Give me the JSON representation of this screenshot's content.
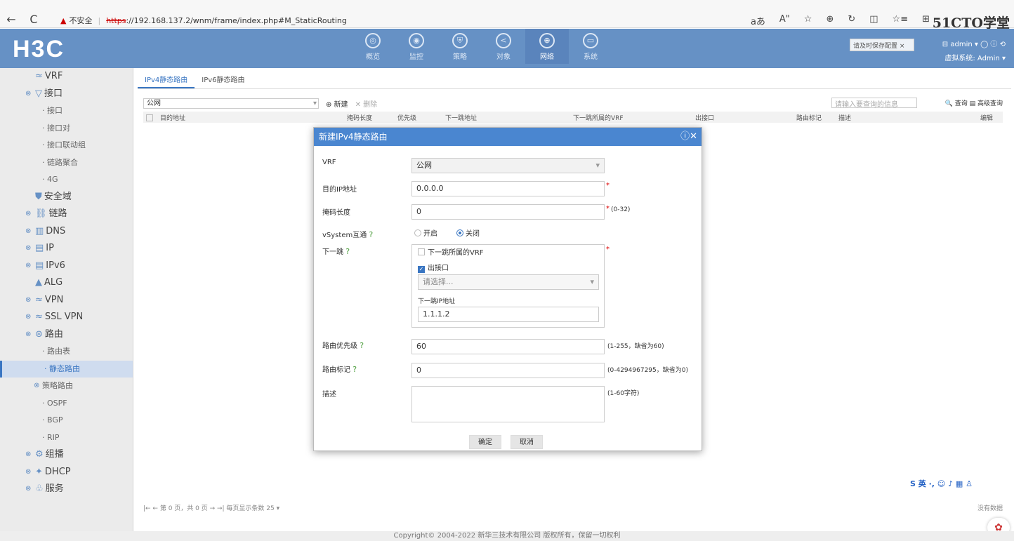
{
  "browser": {
    "back": "←",
    "reload": "C",
    "warning": "▲",
    "insecure": "不安全",
    "https": "https",
    "url": "://192.168.137.2/wnm/frame/index.php#M_StaticRouting",
    "icons": [
      "aあ",
      "A\"",
      "☆",
      "⊕",
      "↻",
      "◫",
      "☆≡",
      "⊞"
    ],
    "brand": "51CTO学堂"
  },
  "header": {
    "logo": "H3C",
    "nav": [
      {
        "icon": "◎",
        "label": "概览"
      },
      {
        "icon": "◉",
        "label": "监控"
      },
      {
        "icon": "⛨",
        "label": "策略"
      },
      {
        "icon": "<",
        "label": "对象"
      },
      {
        "icon": "⊕",
        "label": "网络"
      },
      {
        "icon": "▭",
        "label": "系统"
      }
    ],
    "save_hint": "请及时保存配置",
    "save_close": "×",
    "user": "⊟ admin ▾ ◯ ⓘ ⟲",
    "vsys": "虚拟系统: Admin ▾"
  },
  "sidebar": {
    "items": [
      {
        "label": "VRF",
        "icon": "≈",
        "expand": ""
      },
      {
        "label": "接口",
        "icon": "▽",
        "expand": "⊗"
      },
      {
        "label": "· 接口",
        "sub": true
      },
      {
        "label": "· 接口对",
        "sub": true
      },
      {
        "label": "· 接口联动组",
        "sub": true
      },
      {
        "label": "· 链路聚合",
        "sub": true
      },
      {
        "label": "· 4G",
        "sub": true
      },
      {
        "label": "安全域",
        "icon": "⛊",
        "expand": ""
      },
      {
        "label": "链路",
        "icon": "⛓",
        "expand": "⊗"
      },
      {
        "label": "DNS",
        "icon": "▥",
        "expand": "⊗"
      },
      {
        "label": "IP",
        "icon": "▤",
        "expand": "⊗"
      },
      {
        "label": "IPv6",
        "icon": "▤",
        "expand": "⊗"
      },
      {
        "label": "ALG",
        "icon": "▲",
        "expand": ""
      },
      {
        "label": "VPN",
        "icon": "≈",
        "expand": "⊗"
      },
      {
        "label": "SSL VPN",
        "icon": "≈",
        "expand": "⊗"
      },
      {
        "label": "路由",
        "icon": "⊛",
        "expand": "⊗"
      },
      {
        "label": "· 路由表",
        "sub": true
      },
      {
        "label": "· 静态路由",
        "sub": true,
        "active": true
      },
      {
        "label": "策略路由",
        "sub": true,
        "expand": "⊗"
      },
      {
        "label": "· OSPF",
        "sub": true
      },
      {
        "label": "· BGP",
        "sub": true
      },
      {
        "label": "· RIP",
        "sub": true
      },
      {
        "label": "组播",
        "icon": "⚙",
        "expand": "⊗"
      },
      {
        "label": "DHCP",
        "icon": "✦",
        "expand": "⊗"
      },
      {
        "label": "服务",
        "icon": "♧",
        "expand": "⊗"
      }
    ]
  },
  "content": {
    "tabs": [
      "IPv4静态路由",
      "IPv6静态路由"
    ],
    "vrf": "公网",
    "new_btn": "⊕ 新建",
    "del_btn": "✕ 删除",
    "search_placeholder": "请输入要查询的信息",
    "search_btn": "🔍 查询",
    "adv_btn": "▤ 高级查询",
    "columns": [
      "目的地址",
      "掩码长度",
      "优先级",
      "下一跳地址",
      "下一跳所属的VRF",
      "出接口",
      "路由标记",
      "描述",
      "编辑"
    ],
    "pager": "|← ←  第  0  页，共 0 页  → →|  每页显示条数  25 ▾",
    "nodata": "没有数据"
  },
  "modal": {
    "title": "新建IPv4静态路由",
    "close": "ⓘ✕",
    "vrf_label": "VRF",
    "vrf_value": "公网",
    "dest_label": "目的IP地址",
    "dest_value": "0.0.0.0",
    "mask_label": "掩码长度",
    "mask_value": "0",
    "mask_hint": "(0-32)",
    "vsys_label": "vSystem互通",
    "vsys_on": "开启",
    "vsys_off": "关闭",
    "nexthop_label": "下一跳",
    "nh_vrf": "下一跳所属的VRF",
    "nh_iface": "出接口",
    "nh_select": "请选择...",
    "nh_ip_label": "下一跳IP地址",
    "nh_ip_value": "1.1.1.2",
    "pri_label": "路由优先级",
    "pri_value": "60",
    "pri_hint": "(1-255，缺省为60)",
    "tag_label": "路由标记",
    "tag_value": "0",
    "tag_hint": "(0-4294967295，缺省为0)",
    "desc_label": "描述",
    "desc_hint": "(1-60字符)",
    "ok": "确定",
    "cancel": "取消"
  },
  "ime": "S 英 ·, ☺ ♪ ▦ ♙",
  "footer": "Copyright© 2004-2022 新华三技术有限公司 版权所有，保留一切权利"
}
